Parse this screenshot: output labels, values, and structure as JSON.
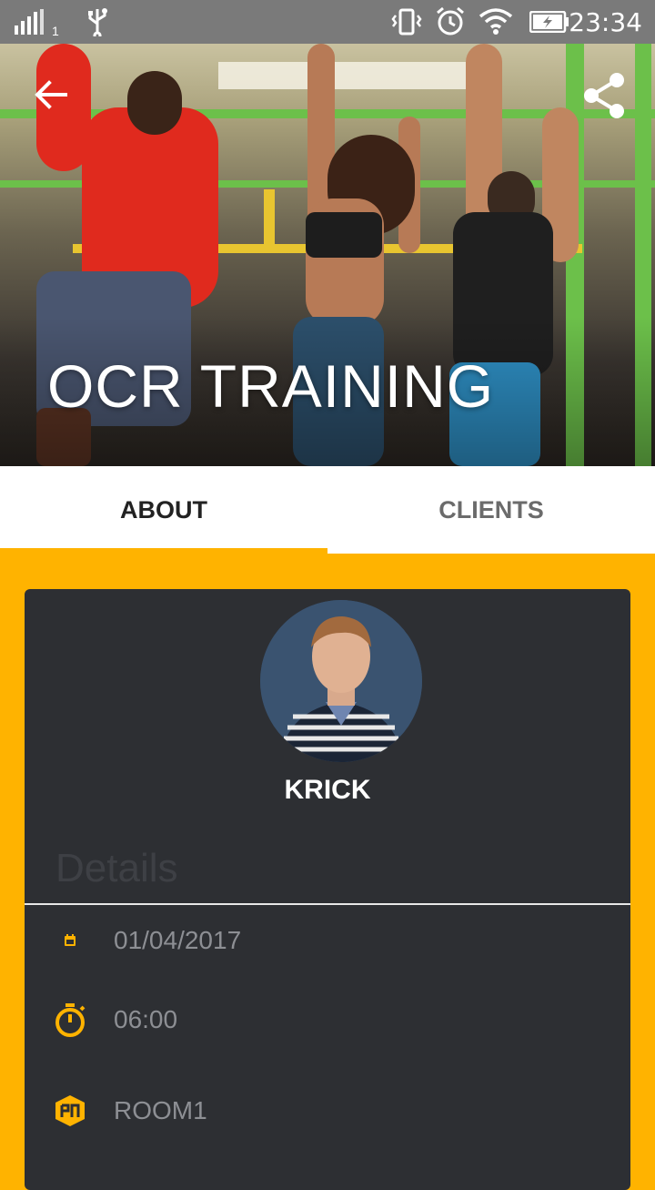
{
  "status_bar": {
    "sim_index": "1",
    "time": "23:34"
  },
  "hero": {
    "title": "OCR TRAINING"
  },
  "tabs": [
    {
      "label": "ABOUT",
      "active": true
    },
    {
      "label": "CLIENTS",
      "active": false
    }
  ],
  "trainer": {
    "name": "KRICK"
  },
  "details": {
    "label": "Details",
    "rows": [
      {
        "icon": "calendar-icon",
        "value": "01/04/2017"
      },
      {
        "icon": "stopwatch-icon",
        "value": "06:00"
      },
      {
        "icon": "room-icon",
        "value": "ROOM1"
      }
    ]
  },
  "colors": {
    "accent": "#FFB300",
    "card": "#2d2f33",
    "status_bar": "#7a7a7a"
  }
}
